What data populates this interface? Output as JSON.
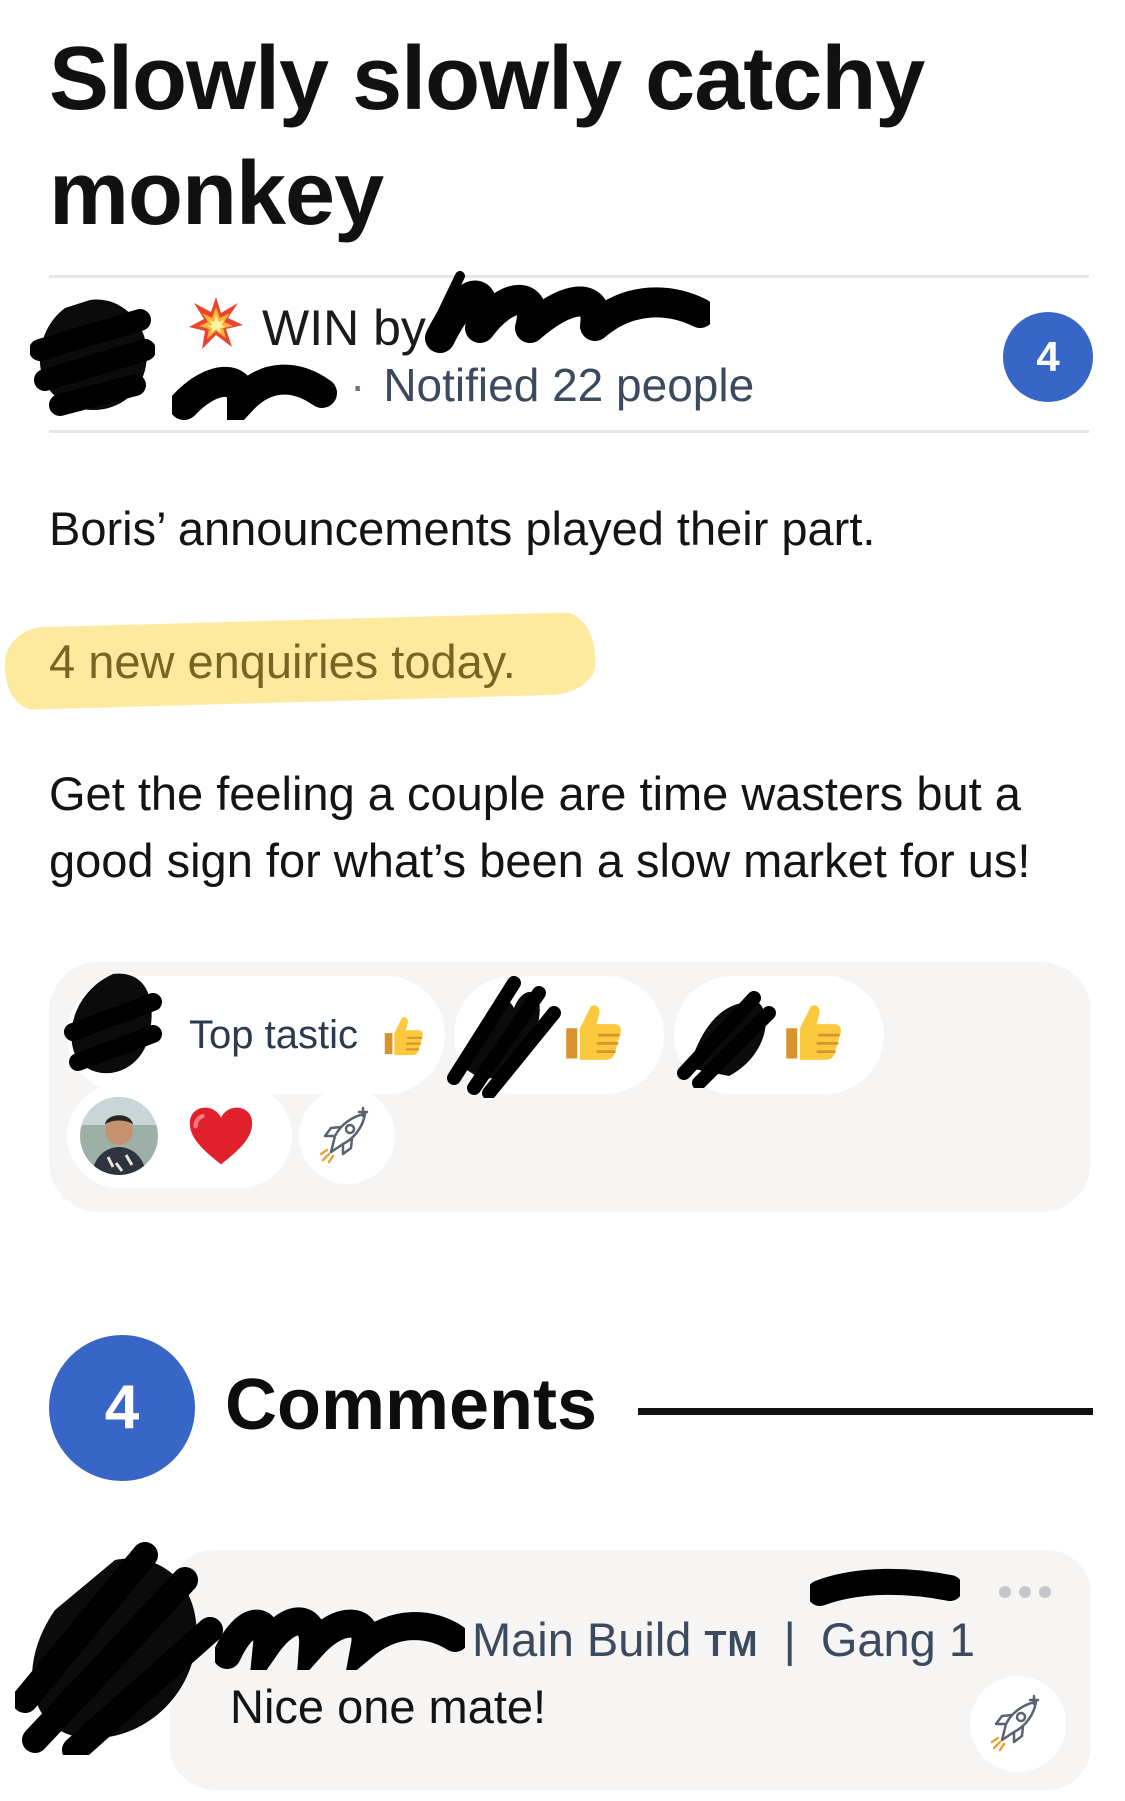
{
  "post": {
    "title": "Slowly slowly catchy monkey",
    "category_label": "WIN by",
    "category_icon": "collision-icon",
    "meta_separator": "·",
    "notified": "Notified 22 people",
    "badge_count": "4",
    "body": {
      "line1": "Boris’ announcements played their part.",
      "line2": "4 new enquiries today.",
      "line3": "Get the feeling a couple are time wasters but a good sign for what’s been a slow market for us!"
    }
  },
  "reactions": {
    "top_label": "Top tastic",
    "items": [
      {
        "emoji": "thumbs-up-icon",
        "label": "Top tastic"
      },
      {
        "emoji": "thumbs-up-icon"
      },
      {
        "emoji": "thumbs-up-icon"
      },
      {
        "emoji": "red-heart-icon"
      }
    ],
    "add_reaction_icon": "rocket-icon"
  },
  "comments": {
    "count": "4",
    "heading": "Comments",
    "items": [
      {
        "site": "Main Build",
        "trademark": "TM",
        "separator": "|",
        "gang": "Gang 1",
        "text": "Nice one mate!"
      }
    ]
  },
  "colors": {
    "accent_blue": "#3866c6",
    "highlight_yellow": "#fce278",
    "card_background": "#f6f5f4",
    "meta_text": "#3b4a5e"
  }
}
